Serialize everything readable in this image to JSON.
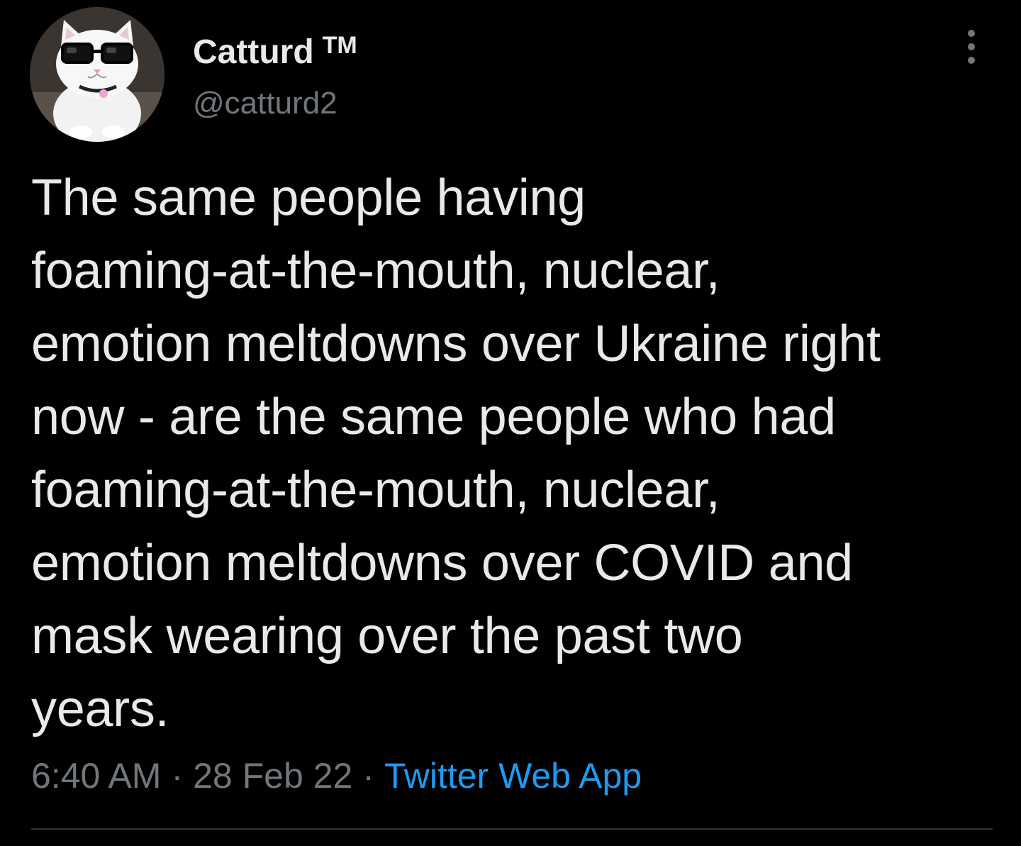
{
  "author": {
    "display_name": "Catturd",
    "badge": "TM",
    "handle": "@catturd2",
    "avatar_icon": "cat-with-glasses-avatar"
  },
  "more_icon": "more-vertical-icon",
  "tweet": {
    "text": "The same people having\nfoaming-at-the-mouth, nuclear,\nemotion meltdowns over Ukraine right\nnow - are the same people who had\nfoaming-at-the-mouth, nuclear,\nemotion meltdowns over COVID and\nmask wearing over the past two\nyears."
  },
  "meta": {
    "time": "6:40 AM",
    "separator": "·",
    "date": "28 Feb 22",
    "source": "Twitter Web App"
  },
  "colors": {
    "background": "#000000",
    "primary_text": "#e7e9ea",
    "secondary_text": "#71767b",
    "link": "#1d9bf0",
    "divider": "#2f3336"
  }
}
